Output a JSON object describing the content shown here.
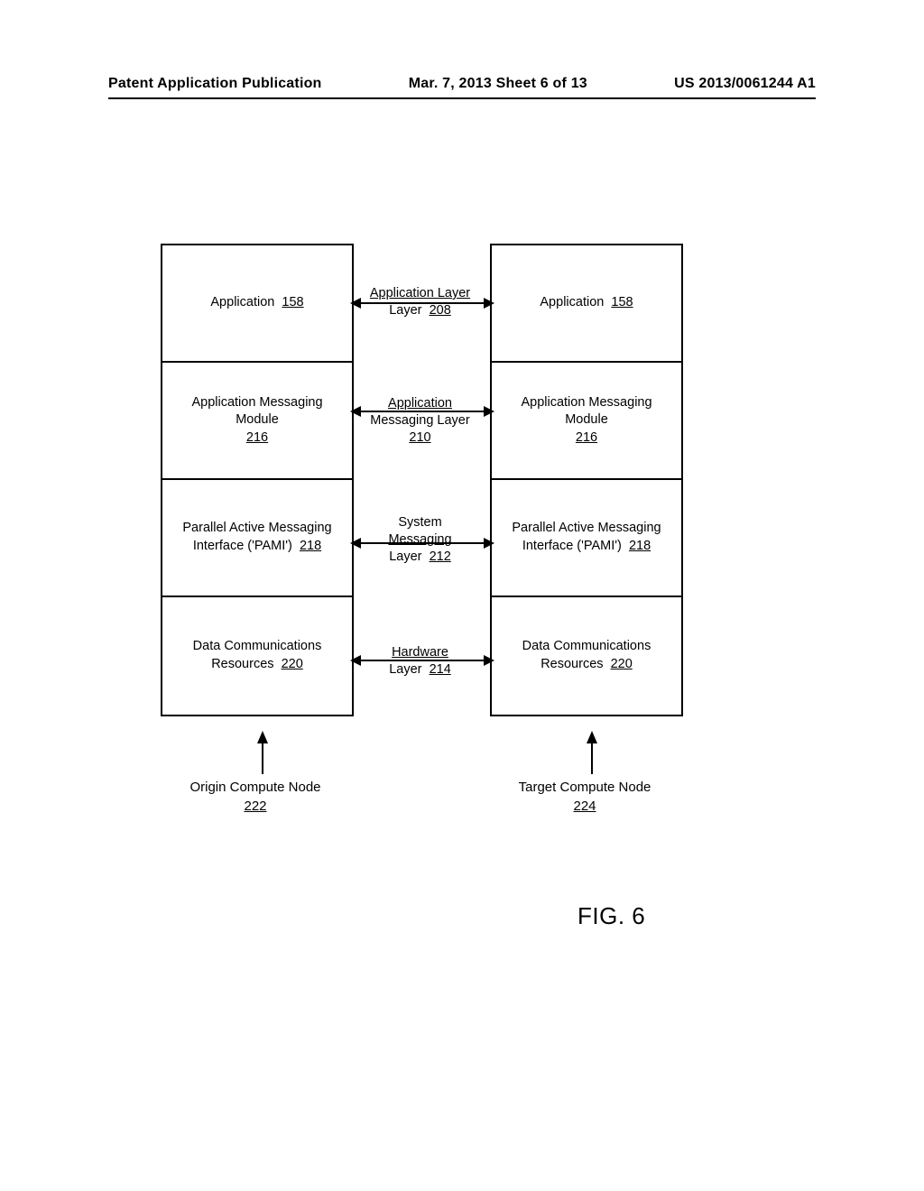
{
  "header": {
    "left": "Patent Application Publication",
    "center": "Mar. 7, 2013  Sheet 6 of 13",
    "right": "US 2013/0061244 A1"
  },
  "left_stack": [
    {
      "label": "Application",
      "ref": "158"
    },
    {
      "label": "Application Messaging Module",
      "ref": "216"
    },
    {
      "label": "Parallel Active Messaging Interface ('PAMI')",
      "ref": "218"
    },
    {
      "label": "Data Communications Resources",
      "ref": "220"
    }
  ],
  "right_stack": [
    {
      "label": "Application",
      "ref": "158"
    },
    {
      "label": "Application Messaging Module",
      "ref": "216"
    },
    {
      "label": "Parallel Active Messaging Interface ('PAMI')",
      "ref": "218"
    },
    {
      "label": "Data Communications Resources",
      "ref": "220"
    }
  ],
  "center_labels": [
    {
      "label": "Application Layer",
      "ref": "208"
    },
    {
      "label": "Application Messaging Layer",
      "ref": "210"
    },
    {
      "label": "System Messaging Layer",
      "ref": "212"
    },
    {
      "label": "Hardware Layer",
      "ref": "214"
    }
  ],
  "nodes": {
    "origin": {
      "label": "Origin Compute Node",
      "ref": "222"
    },
    "target": {
      "label": "Target Compute Node",
      "ref": "224"
    }
  },
  "figure_label": "FIG. 6"
}
